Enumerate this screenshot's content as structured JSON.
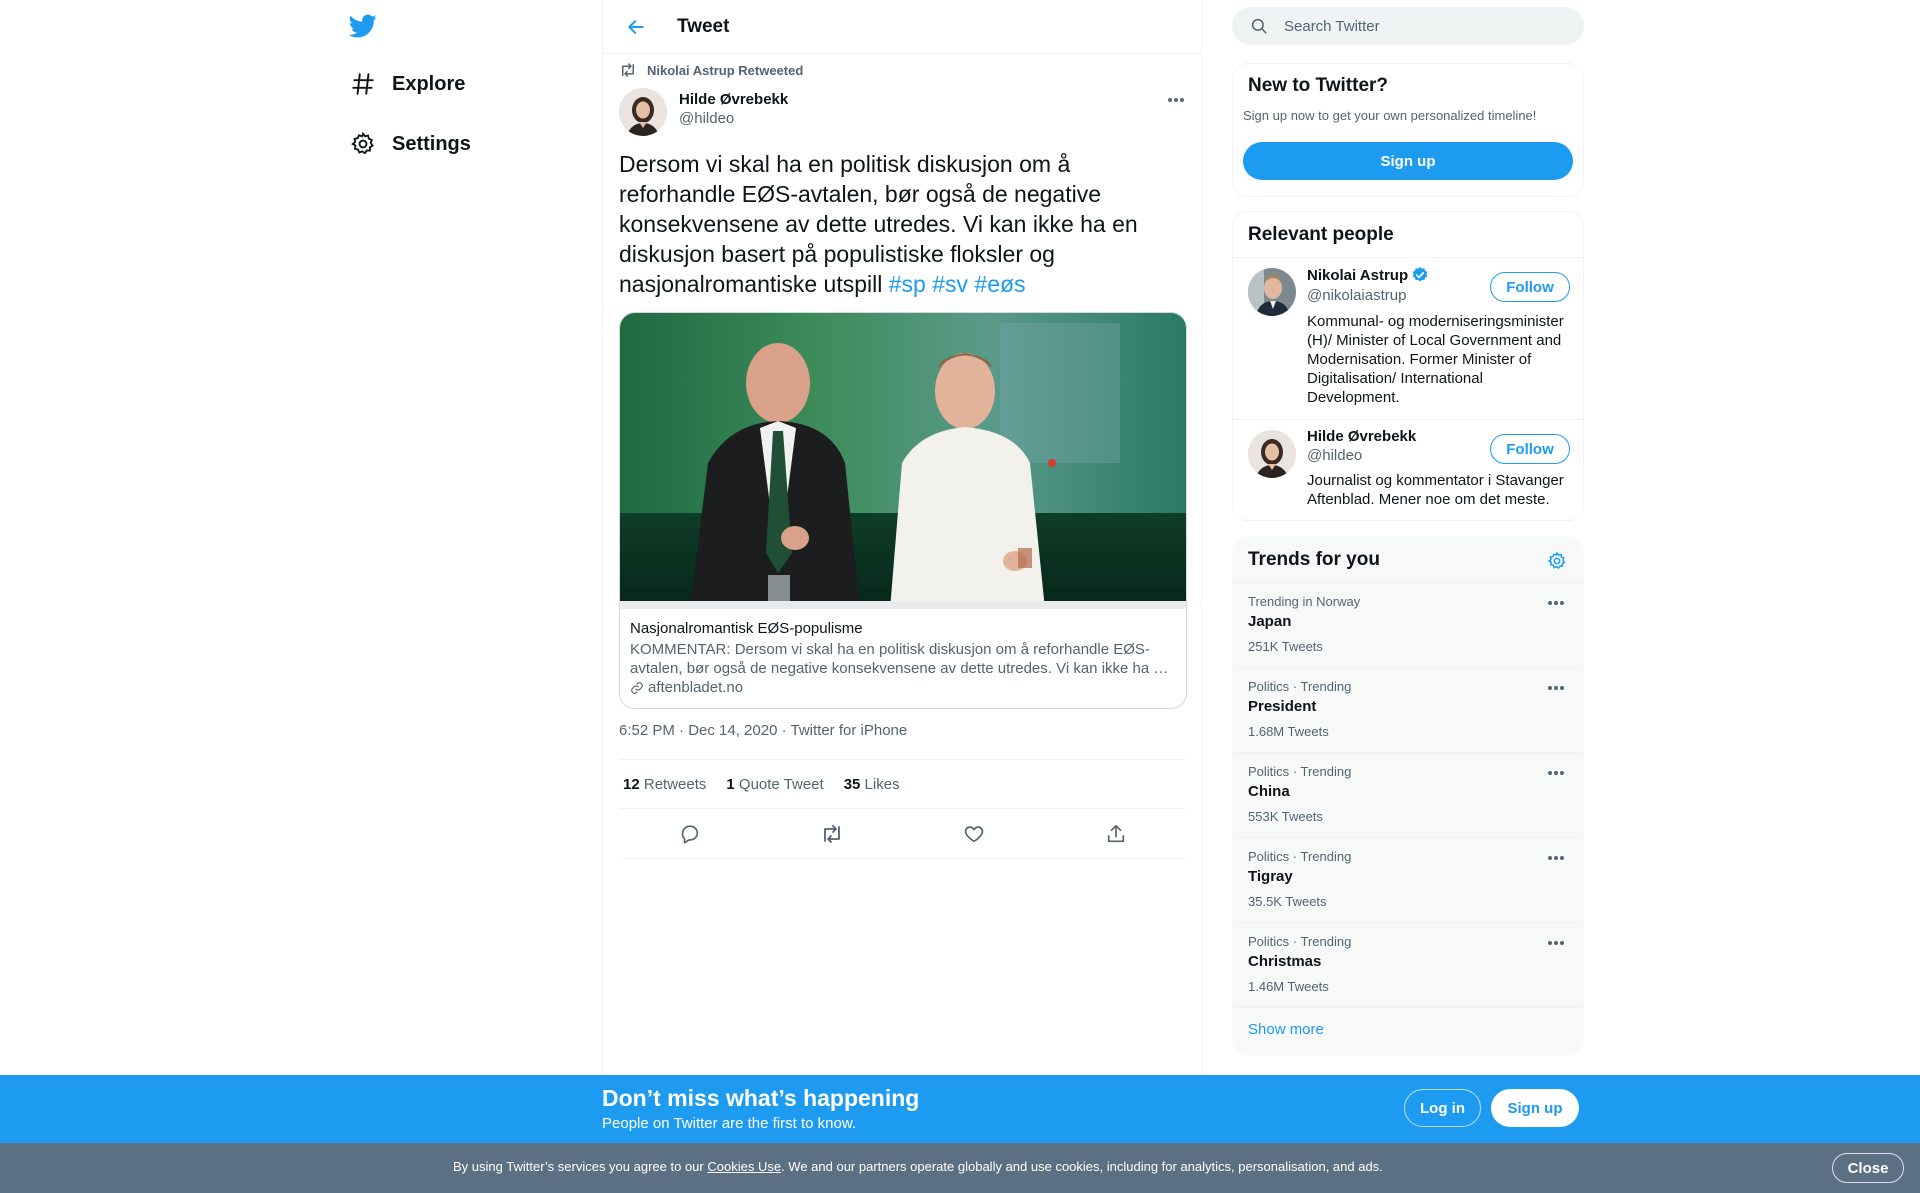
{
  "nav": {
    "items": [
      {
        "label": "Explore",
        "icon": "hashtag-icon"
      },
      {
        "label": "Settings",
        "icon": "gear-icon"
      }
    ]
  },
  "header": {
    "title": "Tweet"
  },
  "tweet": {
    "retweeted_by": "Nikolai Astrup Retweeted",
    "author_name": "Hilde Øvrebekk",
    "author_handle": "@hildeo",
    "text": "Dersom vi skal ha en politisk diskusjon om å reforhandle EØS-avtalen, bør også de negative konsekvensene av dette utredes. Vi kan ikke ha en diskusjon basert på populistiske floksler og nasjonalromantiske utspill",
    "hashtags": [
      "#sp",
      "#sv",
      "#eøs"
    ],
    "card": {
      "title": "Nasjonalromantisk EØS-populisme",
      "description": "KOMMENTAR: Dersom vi skal ha en politisk diskusjon om å reforhandle EØS-avtalen, bør også de negative konsekvensene av dette utredes. Vi kan ikke ha …",
      "domain": "aftenbladet.no"
    },
    "timestamp": "6:52 PM · Dec 14, 2020",
    "separator": " · ",
    "source": "Twitter for iPhone",
    "stats": [
      {
        "count": "12",
        "label": "Retweets"
      },
      {
        "count": "1",
        "label": "Quote Tweet"
      },
      {
        "count": "35",
        "label": "Likes"
      }
    ]
  },
  "search": {
    "placeholder": "Search Twitter"
  },
  "new_panel": {
    "title": "New to Twitter?",
    "subtitle": "Sign up now to get your own personalized timeline!",
    "button": "Sign up"
  },
  "relevant": {
    "title": "Relevant people",
    "people": [
      {
        "name": "Nikolai Astrup",
        "handle": "@nikolaiastrup",
        "verified": true,
        "bio": "Kommunal- og moderniseringsminister (H)/ Minister of Local Government and Modernisation. Former Minister of Digitalisation/ International Development.",
        "button": "Follow"
      },
      {
        "name": "Hilde Øvrebekk",
        "handle": "@hildeo",
        "verified": false,
        "bio": "Journalist og kommentator i Stavanger Aftenblad. Mener noe om det meste.",
        "button": "Follow"
      }
    ]
  },
  "trends": {
    "title": "Trends for you",
    "items": [
      {
        "context": "Trending in Norway",
        "name": "Japan",
        "count": "251K Tweets"
      },
      {
        "context": "Politics · Trending",
        "name": "President",
        "count": "1.68M Tweets"
      },
      {
        "context": "Politics · Trending",
        "name": "China",
        "count": "553K Tweets"
      },
      {
        "context": "Politics · Trending",
        "name": "Tigray",
        "count": "35.5K Tweets"
      },
      {
        "context": "Politics · Trending",
        "name": "Christmas",
        "count": "1.46M Tweets"
      }
    ],
    "show_more": "Show more"
  },
  "bottom_bar": {
    "title": "Don’t miss what’s happening",
    "subtitle": "People on Twitter are the first to know.",
    "login": "Log in",
    "signup": "Sign up"
  },
  "cookie": {
    "prefix": "By using Twitter’s services you agree to our ",
    "link": "Cookies Use",
    "suffix": ". We and our partners operate globally and use cookies, including for analytics, personalisation, and ads.",
    "close": "Close"
  },
  "colors": {
    "accent": "#1d9bf0",
    "text": "#0f1419",
    "secondary": "#536471",
    "cookie_bg": "#5b7083"
  }
}
